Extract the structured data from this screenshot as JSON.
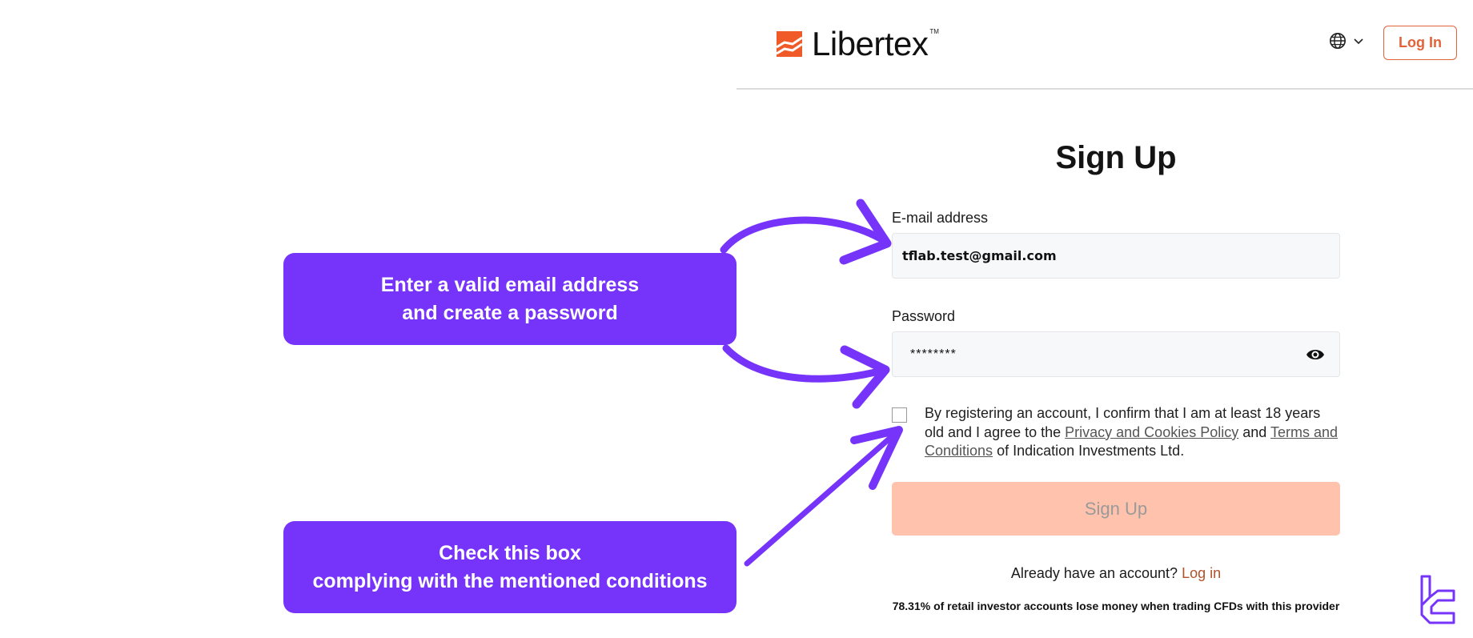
{
  "header": {
    "brand": "Libertex",
    "trademark": "TM",
    "language_icon": "globe-icon",
    "language_chevron": "chevron-down-icon",
    "login_label": "Log In"
  },
  "form": {
    "title": "Sign Up",
    "email_label": "E-mail address",
    "email_value": "tflab.test@gmail.com",
    "password_label": "Password",
    "password_value": "********",
    "password_toggle_icon": "eye-icon",
    "consent_checked": false,
    "consent": {
      "text_before": "By registering an account, I confirm that I am at least 18 years old and I agree to the ",
      "privacy_link": "Privacy and Cookies Policy",
      "text_middle": " and ",
      "terms_link": "Terms and Conditions",
      "text_after": " of Indication Investments Ltd."
    },
    "submit_label": "Sign Up",
    "have_account_text": "Already have an account?",
    "have_account_link": "Log in",
    "risk_disclaimer": "78.31% of retail investor accounts lose money when trading CFDs with this provider"
  },
  "annotations": {
    "callout_1": [
      "Enter a valid email address",
      "and create a password"
    ],
    "callout_2": [
      "Check this box",
      "complying with the mentioned conditions"
    ]
  },
  "colors": {
    "brand_orange": "#e0633a",
    "submit_disabled": "#fec2ad",
    "annotation_purple": "#7634fa"
  }
}
